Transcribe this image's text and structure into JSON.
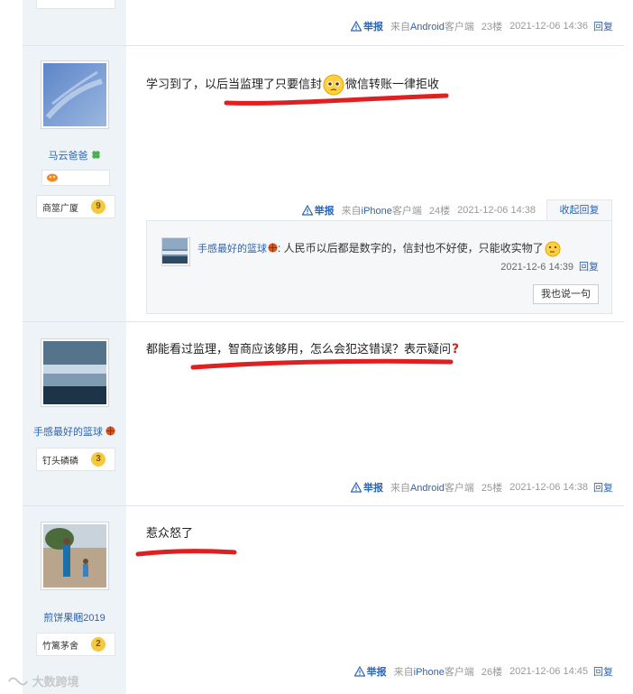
{
  "floors": [
    {
      "id": "23",
      "footer": {
        "report": "举报",
        "client_prefix": "来自",
        "platform": "Android",
        "client_suffix": "客户端",
        "floor": "23楼",
        "time": "2021-12-06 14:36",
        "reply": "回复"
      }
    },
    {
      "id": "24",
      "user": {
        "name": "马云爸爸",
        "title": "商筮广厦",
        "level": "9"
      },
      "content_before": "学习到了，以后当监理了只要信封",
      "content_after": "微信转账一律拒收",
      "footer": {
        "report": "举报",
        "client_prefix": "来自",
        "platform": "iPhone",
        "client_suffix": "客户端",
        "floor": "24楼",
        "time": "2021-12-06 14:38",
        "reply": "收起回复"
      },
      "comment": {
        "user": "手感最好的篮球",
        "text": ": 人民币以后都是数字的，信封也不好使，只能收实物了",
        "time": "2021-12-6 14:39",
        "reply": "回复",
        "say_button": "我也说一句"
      }
    },
    {
      "id": "25",
      "user": {
        "name": "手感最好的篮球",
        "title": "钉头磷磷",
        "level": "3"
      },
      "content": "都能看过监理，智商应该够用，怎么会犯这错误？表示疑问",
      "footer": {
        "report": "举报",
        "client_prefix": "来自",
        "platform": "Android",
        "client_suffix": "客户端",
        "floor": "25楼",
        "time": "2021-12-06 14:38",
        "reply": "回复"
      }
    },
    {
      "id": "26",
      "user": {
        "name": "煎饼果睏2019",
        "title": "竹篱茅舍",
        "level": "2"
      },
      "content": "惹众怒了",
      "footer": {
        "report": "举报",
        "client_prefix": "来自",
        "platform": "iPhone",
        "client_suffix": "客户端",
        "floor": "26楼",
        "time": "2021-12-06 14:45",
        "reply": "回复"
      }
    }
  ],
  "watermark": "大数跨境",
  "colors": {
    "link": "#2d64b3",
    "underline": "#e02020",
    "sidebar": "#eef3f8"
  }
}
